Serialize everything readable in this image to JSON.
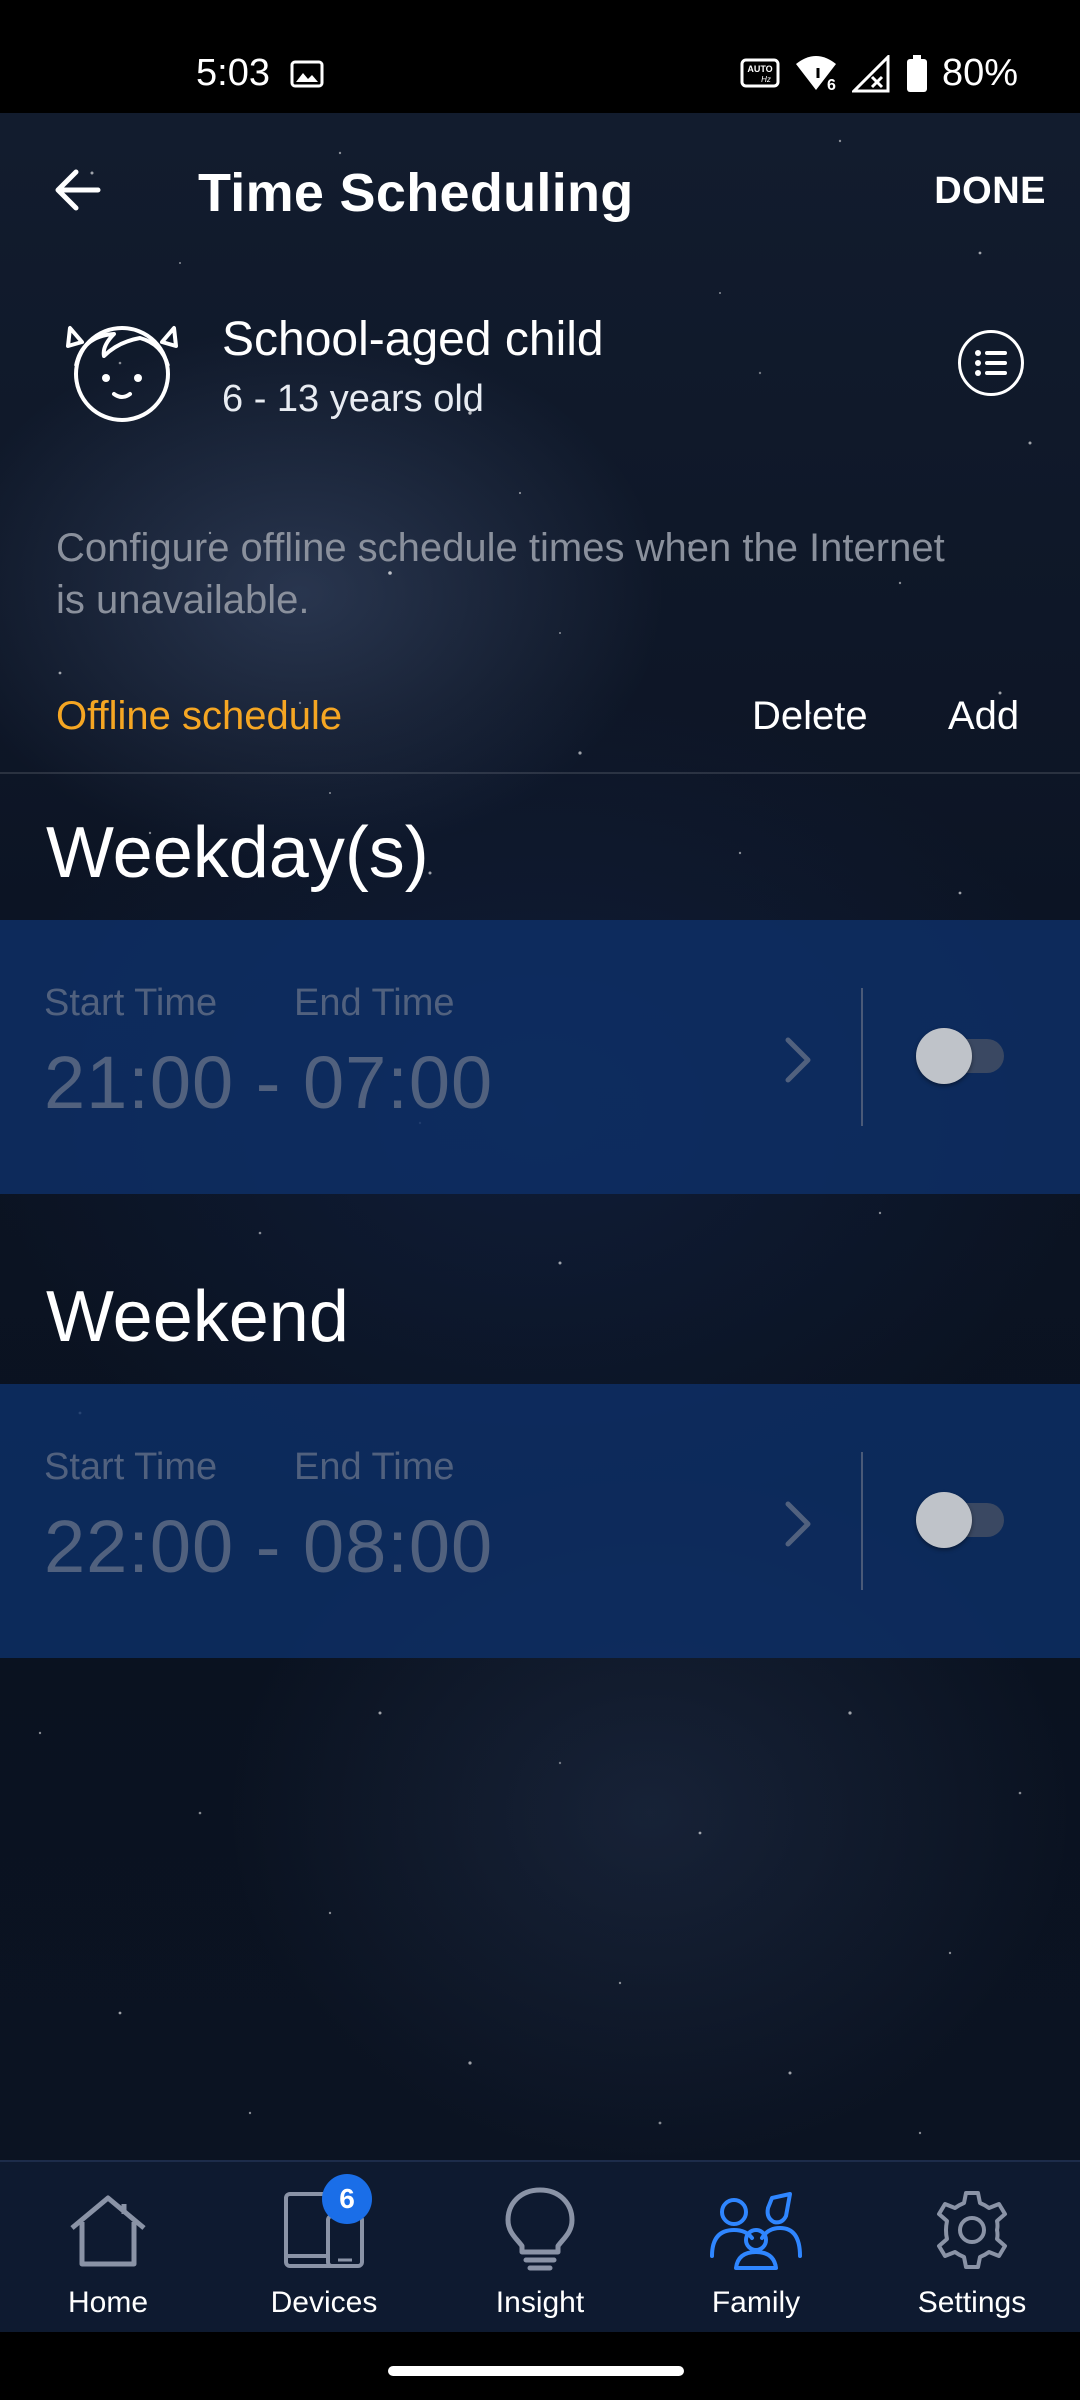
{
  "status_bar": {
    "time": "5:03",
    "battery": "80%",
    "icons": [
      "gallery-icon",
      "auto-hz-icon",
      "wifi-6-icon",
      "no-signal-icon",
      "battery-icon"
    ]
  },
  "header": {
    "title": "Time Scheduling",
    "done_label": "DONE",
    "back_icon": "arrow-left-icon"
  },
  "profile": {
    "name": "School-aged child",
    "age_range": "6 - 13 years old",
    "avatar_icon": "child-face-icon",
    "menu_icon": "list-icon"
  },
  "description": "Configure offline schedule times when the Internet is unavailable.",
  "offline_schedule": {
    "label": "Offline schedule",
    "delete_label": "Delete",
    "add_label": "Add",
    "accent_color": "#f5a623"
  },
  "groups": [
    {
      "title": "Weekday(s)",
      "start_label": "Start Time",
      "end_label": "End Time",
      "times": "21:00 - 07:00",
      "enabled": false
    },
    {
      "title": "Weekend",
      "start_label": "Start Time",
      "end_label": "End Time",
      "times": "22:00 - 08:00",
      "enabled": false
    }
  ],
  "bottom_nav": {
    "items": [
      {
        "label": "Home",
        "icon": "home-icon",
        "active": false
      },
      {
        "label": "Devices",
        "icon": "devices-icon",
        "active": false,
        "badge": "6"
      },
      {
        "label": "Insight",
        "icon": "lightbulb-icon",
        "active": false
      },
      {
        "label": "Family",
        "icon": "family-icon",
        "active": true
      },
      {
        "label": "Settings",
        "icon": "gear-icon",
        "active": false
      }
    ],
    "active_color": "#2f86ff"
  }
}
